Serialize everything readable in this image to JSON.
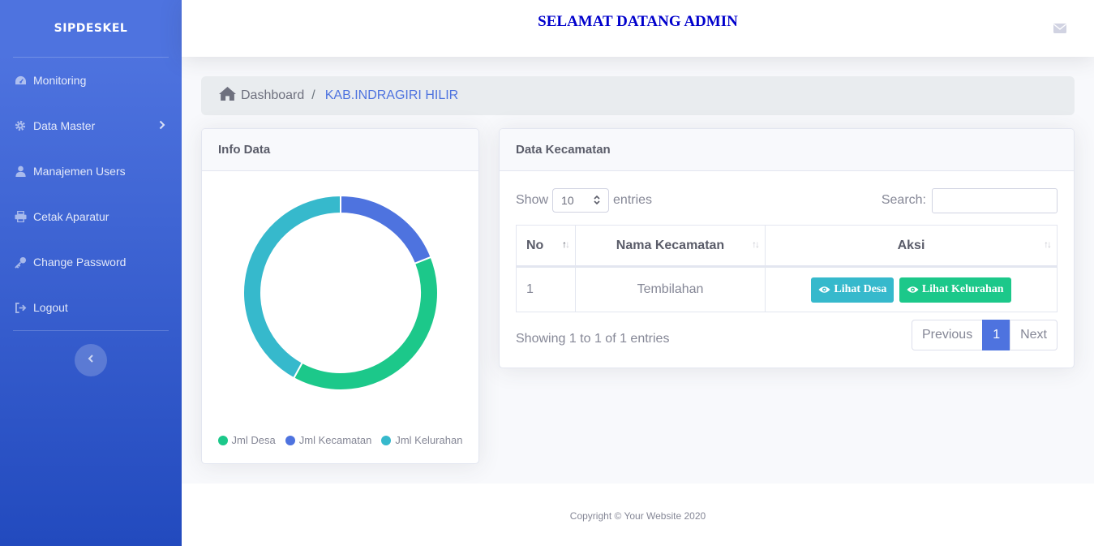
{
  "sidebar": {
    "brand": "SIPDESKEL",
    "items": [
      {
        "label": "Monitoring",
        "icon": "tachometer-icon"
      },
      {
        "label": "Data Master",
        "icon": "cog-icon",
        "has_submenu": true
      },
      {
        "label": "Manajemen Users",
        "icon": "user-icon"
      },
      {
        "label": "Cetak Aparatur",
        "icon": "printer-icon"
      },
      {
        "label": "Change Password",
        "icon": "key-icon"
      },
      {
        "label": "Logout",
        "icon": "sign-out-icon"
      }
    ]
  },
  "topbar": {
    "title": "SELAMAT DATANG ADMIN",
    "title_color": "#0000cc"
  },
  "breadcrumb": {
    "home": "Dashboard",
    "separator": "/",
    "current": "KAB.INDRAGIRI HILIR"
  },
  "info_card": {
    "title": "Info Data"
  },
  "chart_data": {
    "type": "pie",
    "donut": true,
    "title": "",
    "labels": [
      "Jml Desa",
      "Jml Kecamatan",
      "Jml Kelurahan"
    ],
    "values": [
      39,
      19,
      42
    ],
    "colors": [
      "#1cc88a",
      "#4e73df",
      "#36b9cc"
    ],
    "legend_position": "bottom"
  },
  "table_card": {
    "title": "Data Kecamatan",
    "show_label": "Show",
    "entries_value": "10",
    "entries_label": "entries",
    "search_label": "Search:",
    "search_value": "",
    "columns": [
      "No",
      "Nama Kecamatan",
      "Aksi"
    ],
    "rows": [
      {
        "no": "1",
        "nama": "Tembilahan",
        "btn_desa": "Lihat Desa",
        "btn_kelurahan": "Lihat Kelurahan"
      }
    ],
    "info": "Showing 1 to 1 of 1 entries",
    "pagination": {
      "previous": "Previous",
      "current": "1",
      "next": "Next"
    }
  },
  "footer": {
    "text": "Copyright © Your Website 2020"
  }
}
